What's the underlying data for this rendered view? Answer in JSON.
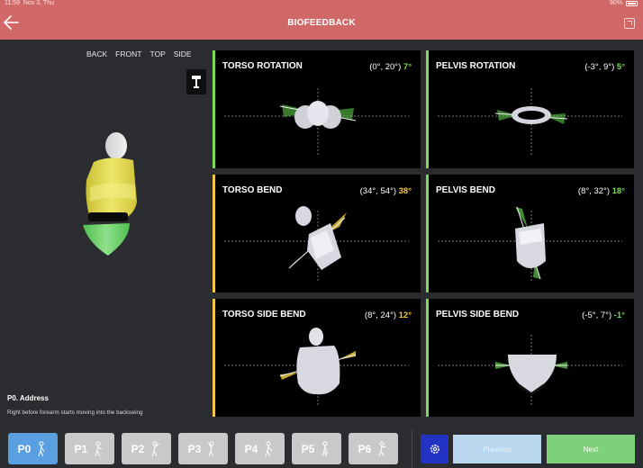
{
  "status_bar": {
    "time": "11:59",
    "date": "Nov 3. Thu",
    "battery": "90%"
  },
  "header": {
    "title": "BIOFEEDBACK"
  },
  "view_tabs": [
    "BACK",
    "FRONT",
    "TOP",
    "SIDE"
  ],
  "position": {
    "label": "P0. Address",
    "description": "Right before forearm starts moving into the backswing"
  },
  "panels": [
    {
      "title": "TORSO ROTATION",
      "range": "(0°, 20°)",
      "value": "7°",
      "value_color": "#7ed957",
      "accent": "#7ed957"
    },
    {
      "title": "PELVIS ROTATION",
      "range": "(-3°, 9°)",
      "value": "5°",
      "value_color": "#7ed957",
      "accent": "#7ed957"
    },
    {
      "title": "TORSO BEND",
      "range": "(34°, 54°)",
      "value": "38°",
      "value_color": "#f3c744",
      "accent": "#f3c744"
    },
    {
      "title": "PELVIS BEND",
      "range": "(8°, 32°)",
      "value": "18°",
      "value_color": "#7ed957",
      "accent": "#7ed957"
    },
    {
      "title": "TORSO SIDE BEND",
      "range": "(8°, 24°)",
      "value": "12°",
      "value_color": "#f3c744",
      "accent": "#f3c744"
    },
    {
      "title": "PELVIS SIDE BEND",
      "range": "(-5°, 7°)",
      "value": "-1°",
      "value_color": "#7ed957",
      "accent": "#7ed957"
    }
  ],
  "positions": [
    "P0",
    "P1",
    "P2",
    "P3",
    "P4",
    "P5",
    "P6"
  ],
  "nav": {
    "previous": "Previous",
    "next": "Next"
  }
}
